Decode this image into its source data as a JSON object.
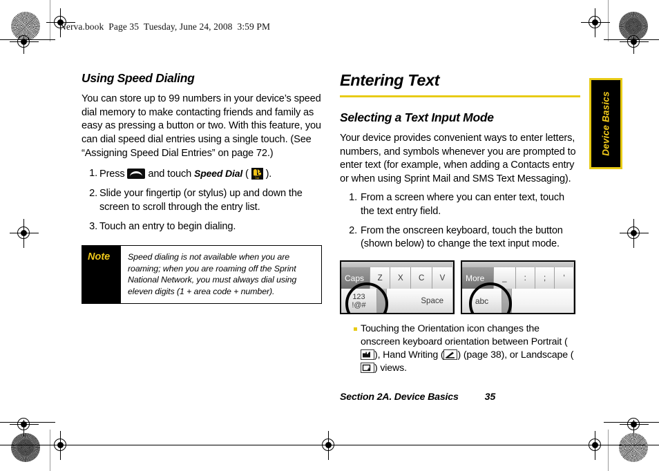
{
  "running_head": "Nerva.book  Page 35  Tuesday, June 24, 2008  3:59 PM",
  "colors": {
    "accent_yellow": "#E8CB16",
    "note_label_yellow": "#EFC81A",
    "text_black": "#000000",
    "tab_background": "#000000"
  },
  "left_column": {
    "heading": "Using Speed Dialing",
    "intro": "You can store up to 99 numbers in your device’s speed dial memory to make contacting friends and family as easy as pressing a button or two. With this feature, you can dial speed dial entries using a single touch. (See “Assigning Speed Dial Entries” on page 72.)",
    "steps": [
      {
        "prefix": "Press ",
        "icon1": "phone-key-icon",
        "middle": " and touch ",
        "emphasis": "Speed Dial",
        "paren_open": " ( ",
        "icon2": "speed-dial-icon",
        "suffix": " )."
      },
      {
        "text": "Slide your fingertip (or stylus) up and down the screen to scroll through the entry list."
      },
      {
        "text": "Touch an entry to begin dialing."
      }
    ],
    "note": {
      "label": "Note",
      "text": "Speed dialing is not available when you are roaming; when you are roaming off the Sprint National Network, you must always dial using eleven digits (1 + area code + number)."
    }
  },
  "right_column": {
    "chapter_heading": "Entering Text",
    "section_heading": "Selecting a Text Input Mode",
    "intro": "Your device provides convenient ways to enter letters, numbers, and symbols whenever you are prompted to enter text (for example, when adding a Contacts entry or when using Sprint Mail and SMS Text Messaging).",
    "steps": [
      {
        "text": "From a screen where you can enter text, touch the text entry field."
      },
      {
        "text": "From the onscreen keyboard, touch the button (shown below) to change the text input mode."
      }
    ],
    "keyboards": [
      {
        "name": "alpha-keyboard-figure",
        "top_row": [
          "Caps",
          "Z",
          "X",
          "C",
          "V"
        ],
        "bottom_row": [
          "123",
          "!@#",
          "Space"
        ],
        "highlighted_key": "123 !@#"
      },
      {
        "name": "symbol-keyboard-figure",
        "top_row": [
          "More",
          "_",
          ":",
          ";",
          "‘"
        ],
        "bottom_row": [
          "abc"
        ],
        "highlighted_key": "abc"
      }
    ],
    "bullets": [
      {
        "part1": "Touching the Orientation icon changes the onscreen keyboard orientation between Portrait (",
        "icon1": "portrait-orientation-icon",
        "part2": "), Hand Writing (",
        "icon2": "hand-writing-icon",
        "part3": ") (page 38), or Landscape (",
        "icon3": "landscape-orientation-icon",
        "part4": ") views."
      }
    ]
  },
  "thumb_tab": {
    "label": "Device Basics"
  },
  "footer": {
    "section": "Section 2A. Device Basics",
    "page_number": "35"
  }
}
